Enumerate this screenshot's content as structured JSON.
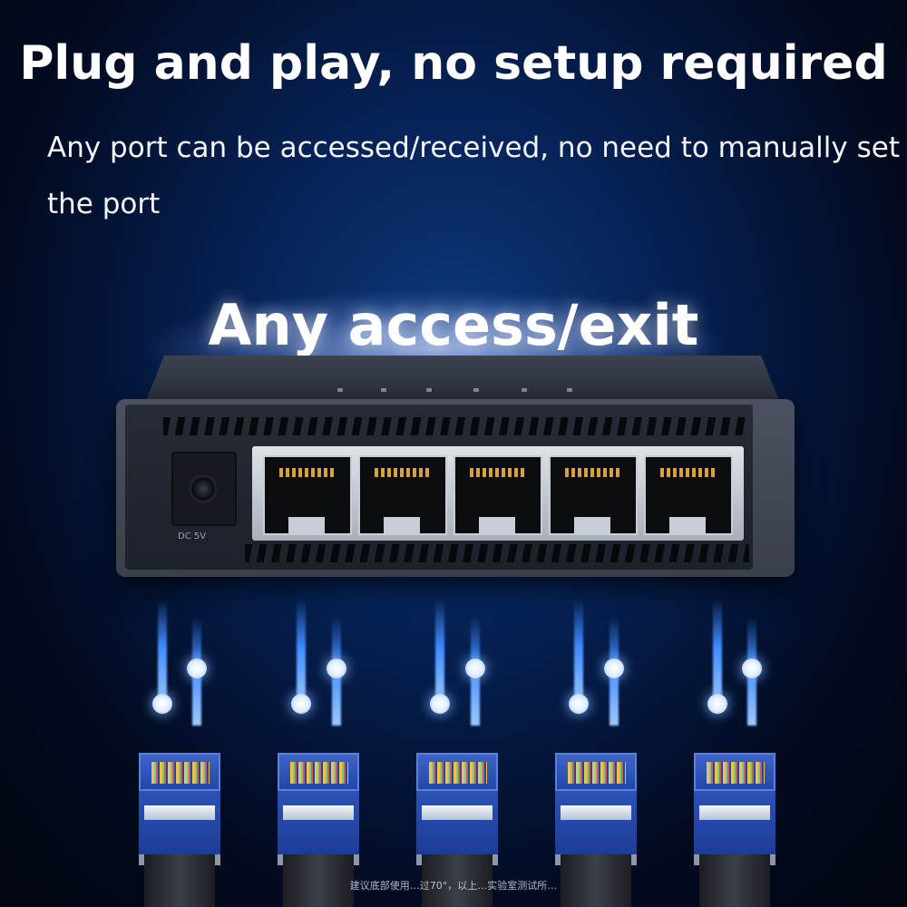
{
  "headline": "Plug and play, no setup required",
  "subline": "Any port can be accessed/received, no need to manually set the port",
  "banner": "Any access/exit",
  "device": {
    "power_label": "DC 5V",
    "port_count": 5
  },
  "cable_count": 5,
  "footnote": "建议底部使用…过70°，以上…实验室测试所…",
  "colors": {
    "background": "#062154",
    "cable_glow": "#3f8dff",
    "plug_blue": "#2347a8",
    "port_pins": "#d7a23a"
  }
}
